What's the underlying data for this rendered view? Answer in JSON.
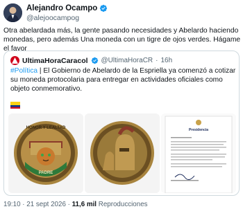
{
  "author": {
    "name": "Alejandro Ocampo",
    "handle": "@alejoocampog",
    "verified_icon": "verified-badge-icon"
  },
  "tweet": {
    "text": "Otra abelardada más, la gente pasando necesidades y Abelardo haciendo monedas, pero además Una moneda con un tigre de ojos verdes. Hágame el favor"
  },
  "quoted": {
    "name": "UltimaHoraCaracol",
    "handle": "@UltimaHoraCR",
    "dot": "·",
    "time": "16h",
    "hashtag": "#Política",
    "text": " | El Gobierno de Abelardo de la Espriella ya comenzó a cotizar su moneda protocolaria para entregar en actividades oficiales como objeto conmemorativo.",
    "flag_icon": "colombia-flag-icon",
    "media": [
      {
        "alt": "tiger-coin-image",
        "legend_top": "HONOR Y LEALTAD",
        "legend_bottom": "PADRE"
      },
      {
        "alt": "spartan-coin-image"
      },
      {
        "alt": "presidencia-document-image",
        "heading": "Presidencia"
      }
    ],
    "colors": {
      "hashtag": "#1d9bf0",
      "avatar": "#d0021b"
    }
  },
  "meta": {
    "time": "19:10",
    "sep1": " · ",
    "date": "21 sept 2026",
    "sep2": " · ",
    "views_count": "11,6 mil",
    "views_label": " Reproducciones"
  },
  "colors": {
    "accent": "#1d9bf0",
    "secondary_text": "#536471",
    "border": "#cfd9de"
  }
}
